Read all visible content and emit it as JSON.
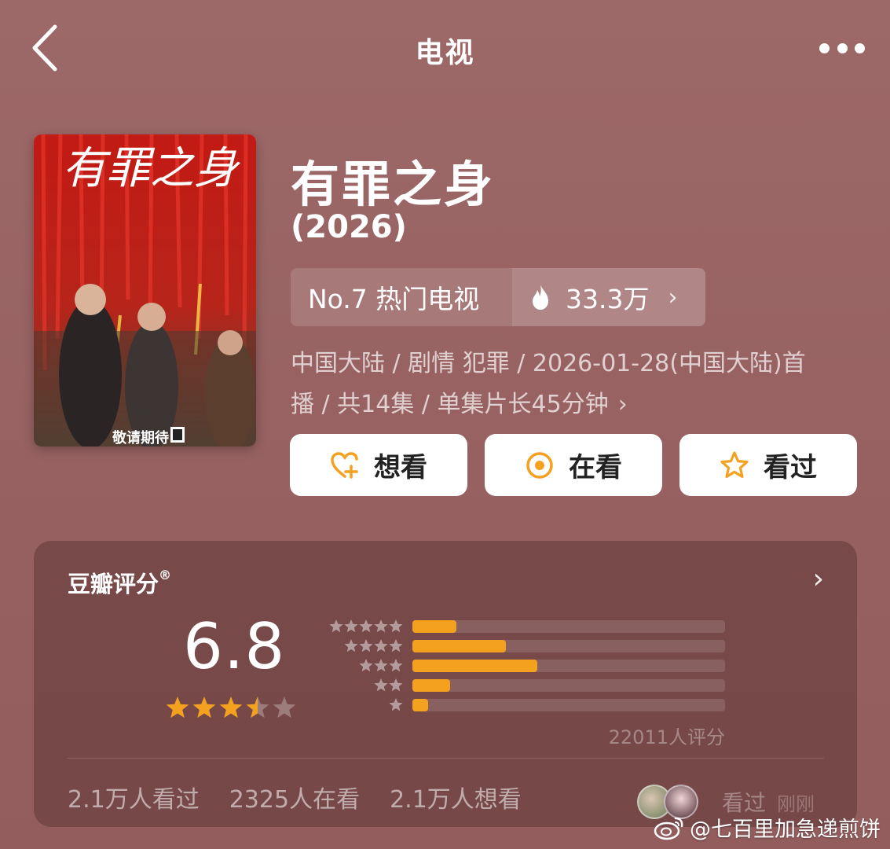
{
  "nav": {
    "title": "电视"
  },
  "show": {
    "poster_text": "有罪之身",
    "poster_tag": "敬请期待",
    "title": "有罪之身",
    "year": "(2026)",
    "rank_label": "No.7 热门电视",
    "heat": "33.3万",
    "meta_line1": "中国大陆 / 剧情 犯罪 / 2026-01-28(中国大陆)首",
    "meta_line2": "播 / 共14集 / 单集片长45分钟"
  },
  "actions": {
    "want_label": "想看",
    "watching_label": "在看",
    "watched_label": "看过"
  },
  "rating": {
    "title": "豆瓣评分",
    "mark": "®",
    "score": "6.8",
    "score_value": 6.8,
    "stars_filled": 3.5,
    "distribution": [
      {
        "stars": 5,
        "fraction": 0.14
      },
      {
        "stars": 4,
        "fraction": 0.3
      },
      {
        "stars": 3,
        "fraction": 0.4
      },
      {
        "stars": 2,
        "fraction": 0.12
      },
      {
        "stars": 1,
        "fraction": 0.05
      }
    ],
    "count_label": "22011人评分"
  },
  "stats": {
    "watched": "2.1万人看过",
    "watching": "2325人在看",
    "want": "2.1万人想看"
  },
  "friends": {
    "label": "看过",
    "time": "刚刚"
  },
  "watermark": {
    "text": "@七百里加急递煎饼"
  },
  "colors": {
    "accent": "#f5a120",
    "background": "#9a6464"
  }
}
